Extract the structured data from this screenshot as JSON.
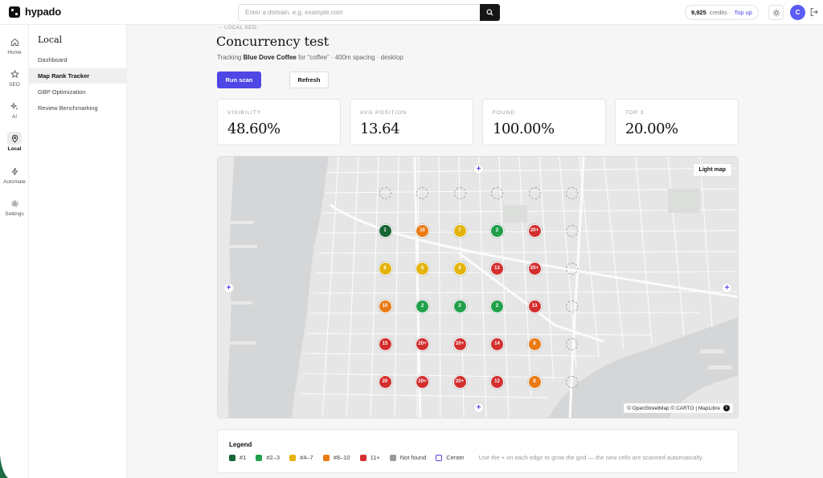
{
  "app": {
    "name": "hypado"
  },
  "search": {
    "placeholder": "Enter a domain, e.g. example.com"
  },
  "account": {
    "credits": "9,925",
    "credits_label": "credits ·",
    "topup_label": "Top up",
    "avatar_initial": "C"
  },
  "rail": [
    {
      "label": "Home",
      "icon": "home-icon"
    },
    {
      "label": "SEO",
      "icon": "star-icon"
    },
    {
      "label": "AI",
      "icon": "sparkle-icon"
    },
    {
      "label": "Local",
      "icon": "map-pin-icon",
      "active": true
    },
    {
      "label": "Automate",
      "icon": "bolt-icon"
    },
    {
      "label": "Settings",
      "icon": "gear-icon"
    }
  ],
  "subnav": {
    "title": "Local",
    "items": [
      "Dashboard",
      "Map Rank Tracker",
      "GBP Optimization",
      "Review Benchmarking"
    ],
    "active_index": 1
  },
  "page": {
    "breadcrumb": "← LOCAL SEO",
    "title": "Concurrency test",
    "subtitle_prefix": "Tracking ",
    "business": "Blue Dove Coffee",
    "subtitle_suffix": " for “coffee” · 400m spacing · desktop",
    "run_label": "Run scan",
    "refresh_label": "Refresh"
  },
  "stats": [
    {
      "label": "VISIBILITY",
      "value": "48.60%"
    },
    {
      "label": "AVG POSITION",
      "value": "13.64"
    },
    {
      "label": "FOUND",
      "value": "100.00%"
    },
    {
      "label": "TOP 3",
      "value": "20.00%"
    }
  ],
  "map": {
    "style_button": "Light map",
    "attribution": "© OpenStreetMap © CARTO | MapLibre",
    "info_glyph": "i",
    "grid": [
      [
        "ghost",
        "ghost",
        "ghost",
        "ghost",
        "ghost",
        "ghost"
      ],
      [
        "1",
        "10",
        "7",
        "2",
        "20+",
        "ghost"
      ],
      [
        "6",
        "5",
        "6",
        "13",
        "20+",
        "ghost"
      ],
      [
        "10",
        "2",
        "2",
        "2",
        "13",
        "ghost"
      ],
      [
        "15",
        "20+",
        "20+",
        "14",
        "8",
        "ghost"
      ],
      [
        "20",
        "20+",
        "20+",
        "12",
        "8",
        "ghost"
      ]
    ]
  },
  "legend": {
    "title": "Legend",
    "items": [
      {
        "label": "#1",
        "color": "#166534"
      },
      {
        "label": "#2–3",
        "color": "#22a04b"
      },
      {
        "label": "#4–7",
        "color": "#e4b40e"
      },
      {
        "label": "#8–10",
        "color": "#ea7a14"
      },
      {
        "label": "11+",
        "color": "#d32f2f"
      },
      {
        "label": "Not found",
        "color": "#9a9a9a"
      },
      {
        "label": "Center",
        "color": "#4f46e5"
      }
    ],
    "note": "Use the + on each edge to grow the grid — the new cells are scanned automatically."
  },
  "colors": {
    "accent": "#4f46e5",
    "rank_1": "#166534",
    "rank_2_3": "#22a04b",
    "rank_4_7": "#e4b40e",
    "rank_8_10": "#ea7a14",
    "rank_11_plus": "#d32f2f"
  }
}
